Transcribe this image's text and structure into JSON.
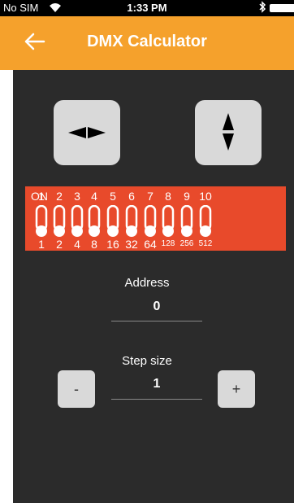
{
  "status_bar": {
    "carrier": "No SIM",
    "time": "1:33 PM"
  },
  "nav": {
    "title": "DMX Calculator",
    "back_icon": "back-arrow-icon"
  },
  "buttons": {
    "horizontal_icon": "arrows-left-right-icon",
    "vertical_icon": "arrows-up-down-icon"
  },
  "dip": {
    "on_label": "ON",
    "numbers": [
      "1",
      "2",
      "3",
      "4",
      "5",
      "6",
      "7",
      "8",
      "9",
      "10"
    ],
    "weights": [
      "1",
      "2",
      "4",
      "8",
      "16",
      "32",
      "64",
      "128",
      "256",
      "512"
    ],
    "states": [
      false,
      false,
      false,
      false,
      false,
      false,
      false,
      false,
      false,
      false
    ],
    "color": "#e84a2b"
  },
  "address": {
    "label": "Address",
    "value": "0"
  },
  "step": {
    "label": "Step size",
    "value": "1",
    "minus": "-",
    "plus": "+"
  },
  "colors": {
    "accent": "#f5a12c",
    "background": "#2b2b2b"
  }
}
